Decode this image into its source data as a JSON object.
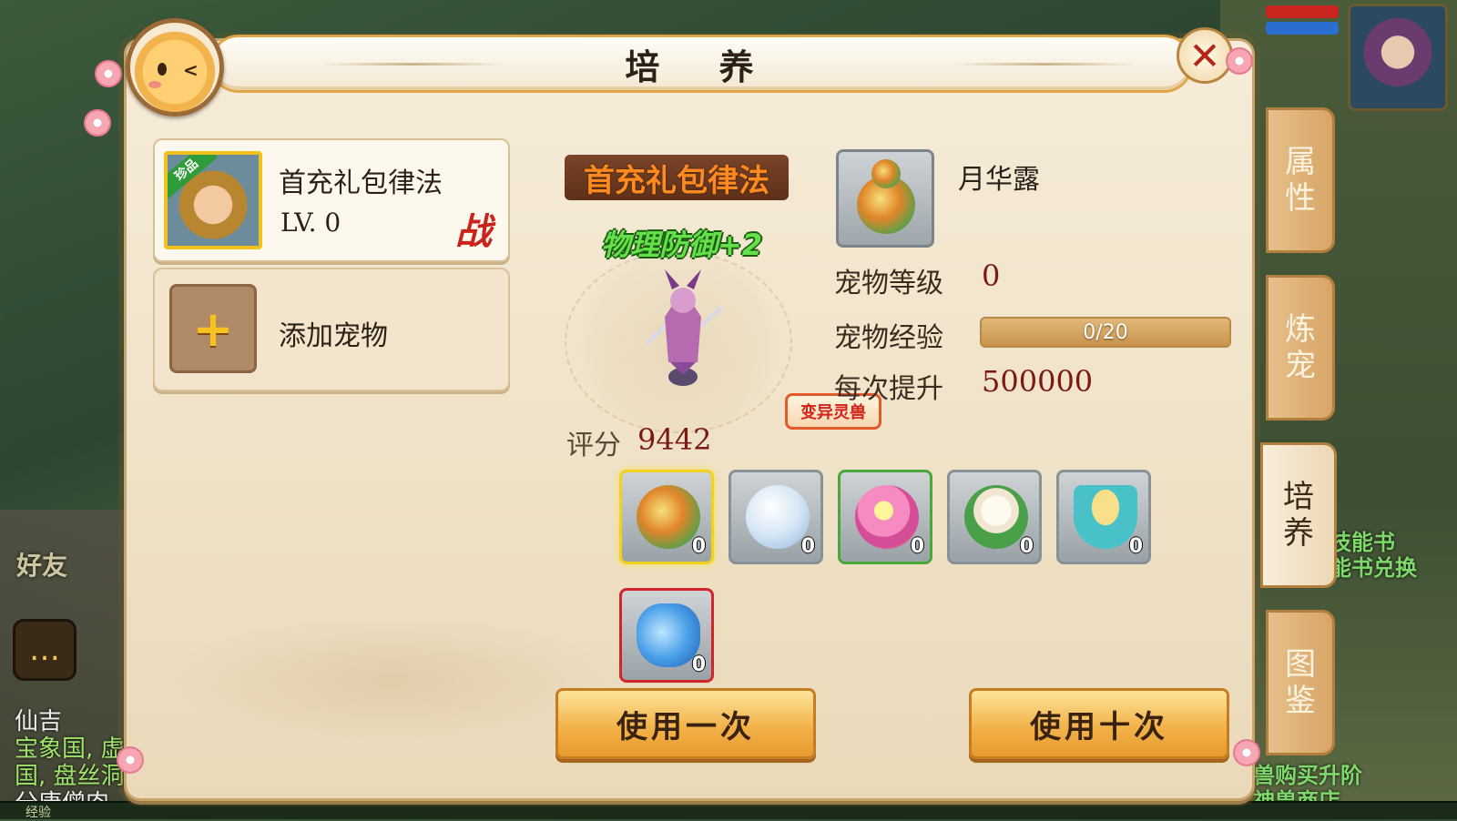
{
  "background": {
    "friend_label": "好友",
    "chat_lines": [
      "宝象国, 虚",
      "国, 盘丝洞",
      "分唐僧肉"
    ],
    "chat_header": "仙吉",
    "side_hint_1": "技能书",
    "side_hint_2": "能书兑换",
    "side_hint_3": "兽购买升阶",
    "side_hint_4": "神兽商店",
    "bottom_label": "经验"
  },
  "window": {
    "title": "培 养",
    "close_icon": "close-icon"
  },
  "pet_list": {
    "selected_pet": {
      "name": "首充礼包律法",
      "level": "LV. 0",
      "rarity_tag": "珍品",
      "battle_badge": "战"
    },
    "add_pet_label": "添加宠物"
  },
  "pet_display": {
    "name_plate": "首充礼包律法",
    "buff_text": "物理防御+2",
    "mutant_tag": "变异灵兽",
    "score_label": "评分",
    "score_value": "9442"
  },
  "item_info": {
    "name": "月华露",
    "level_label": "宠物等级",
    "level_value": "0",
    "exp_label": "宠物经验",
    "exp_value": "0/20",
    "exp_fraction": 0,
    "boost_label": "每次提升",
    "boost_value": "500000("
  },
  "items": [
    {
      "icon": "gourd-icon",
      "count": "0",
      "state": "selected"
    },
    {
      "icon": "snowball-icon",
      "count": "0",
      "state": "normal"
    },
    {
      "icon": "lollipop-icon",
      "count": "0",
      "state": "green"
    },
    {
      "icon": "flower-bun-icon",
      "count": "0",
      "state": "normal"
    },
    {
      "icon": "noodle-bowl-icon",
      "count": "0",
      "state": "normal"
    },
    {
      "icon": "blue-vase-icon",
      "count": "0",
      "state": "red"
    }
  ],
  "actions": {
    "use_once": "使用一次",
    "use_ten": "使用十次"
  },
  "side_tabs": [
    {
      "label": "属\n性",
      "active": false
    },
    {
      "label": "炼\n宠",
      "active": false
    },
    {
      "label": "培\n养",
      "active": true
    },
    {
      "label": "图\n鉴",
      "active": false
    }
  ],
  "colors": {
    "title_border": "#e1a54a",
    "accent_orange": "#ff8a1f",
    "value_red": "#7a1a12",
    "buff_green": "#64e04a"
  }
}
